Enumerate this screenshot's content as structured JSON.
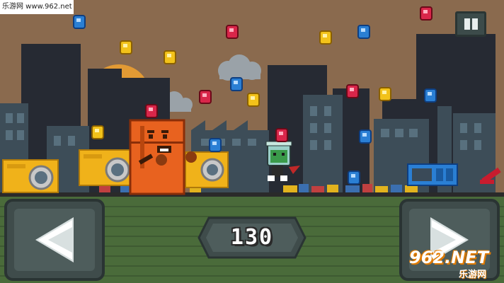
{
  "watermark_top": "乐游网 www.962.net",
  "watermark_bottom": {
    "brand": "962.NET",
    "sub": "乐游网"
  },
  "hud": {
    "score": "130",
    "pause_icon": "pause-icon",
    "left_icon": "arrow-left-icon",
    "right_icon": "arrow-right-icon"
  },
  "colors": {
    "sky": "#8a6a4e",
    "building_dark": "#262a33",
    "building_slate": "#3d4d58",
    "sun": "#e29a34",
    "ground_wall": "#4a6b3a",
    "control_panel": "#3f4c4b",
    "gem_red": "#d9264a",
    "gem_blue": "#2a7fd4",
    "gem_yellow": "#f2c21a"
  }
}
